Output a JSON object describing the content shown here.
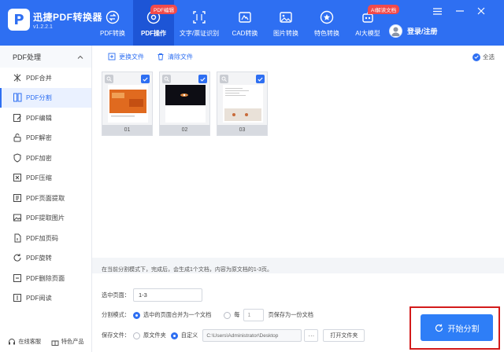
{
  "app": {
    "name": "迅捷PDF转换器",
    "version": "v1.2.2.1"
  },
  "nav": [
    {
      "label": "PDF转换",
      "badge": ""
    },
    {
      "label": "PDF操作",
      "badge": "PDF编辑",
      "active": true
    },
    {
      "label": "文字/票证识别",
      "badge": ""
    },
    {
      "label": "CAD转换",
      "badge": ""
    },
    {
      "label": "图片转换",
      "badge": ""
    },
    {
      "label": "特色转换",
      "badge": ""
    },
    {
      "label": "AI大模型",
      "badge": "AI解读文档"
    }
  ],
  "user": {
    "login_label": "登录/注册"
  },
  "sidebar": {
    "header": "PDF处理",
    "items": [
      {
        "label": "PDF合并",
        "icon": "merge-icon"
      },
      {
        "label": "PDF分割",
        "icon": "split-icon",
        "active": true
      },
      {
        "label": "PDF编辑",
        "icon": "edit-icon"
      },
      {
        "label": "PDF解密",
        "icon": "unlock-icon"
      },
      {
        "label": "PDF加密",
        "icon": "shield-icon"
      },
      {
        "label": "PDF压缩",
        "icon": "compress-icon"
      },
      {
        "label": "PDF页面提取",
        "icon": "extract-page-icon"
      },
      {
        "label": "PDF提取图片",
        "icon": "image-icon"
      },
      {
        "label": "PDF加页码",
        "icon": "page-number-icon"
      },
      {
        "label": "PDF旋转",
        "icon": "rotate-icon"
      },
      {
        "label": "PDF删除页面",
        "icon": "delete-page-icon"
      },
      {
        "label": "PDF阅读",
        "icon": "read-icon"
      }
    ],
    "footer": {
      "service": "在线客服",
      "featured": "特色产品"
    }
  },
  "toolbar": {
    "replace_file": "更换文件",
    "clear_file": "清除文件",
    "select_all": "全选"
  },
  "thumbnails": [
    {
      "label": "01",
      "checked": true
    },
    {
      "label": "02",
      "checked": true
    },
    {
      "label": "03",
      "checked": true
    }
  ],
  "note": "在当前分割模式下，完成后，会生成1个文档，内容为原文档的1-3页。",
  "form": {
    "selected_pages_label": "选中页面：",
    "selected_pages_value": "1-3",
    "mode_label": "分割模式：",
    "mode_option1": "选中的页面合并为一个文档",
    "mode_option2_prefix": "每",
    "mode_option2_value": "1",
    "mode_option2_suffix": "页保存为一份文档",
    "save_label": "保存文件：",
    "save_original": "原文件夹",
    "save_custom": "自定义",
    "save_path": "C:\\Users\\Administrator\\Desktop",
    "browse": "···",
    "open_folder": "打开文件夹"
  },
  "start_button": "开始分割",
  "colors": {
    "brand": "#2e6ff2",
    "highlight_border": "#d31b1b"
  }
}
